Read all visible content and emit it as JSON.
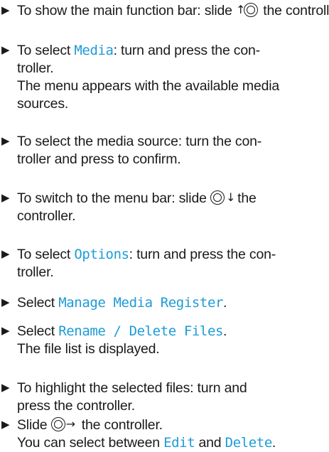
{
  "steps": [
    {
      "lines": [
        [
          {
            "t": "To show the main function bar: slide "
          },
          {
            "icon": "slide-up"
          },
          {
            "t": " the controller."
          }
        ]
      ]
    },
    {
      "lines": [
        [
          {
            "t": "To select "
          },
          {
            "ui": "Media"
          },
          {
            "t": ": turn and press the con-"
          }
        ],
        [
          {
            "t": "troller."
          }
        ],
        [
          {
            "t": "The menu appears with the available media"
          }
        ],
        [
          {
            "t": "sources."
          }
        ]
      ]
    },
    {
      "lines": [
        [
          {
            "t": "To select the media source: turn the con-"
          }
        ],
        [
          {
            "t": "troller and press to confirm."
          }
        ]
      ]
    },
    {
      "lines": [
        [
          {
            "t": "To switch to the menu bar: slide "
          },
          {
            "icon": "slide-down"
          },
          {
            "t": " the"
          }
        ],
        [
          {
            "t": "controller."
          }
        ]
      ]
    },
    {
      "lines": [
        [
          {
            "t": "To select "
          },
          {
            "ui": "Options"
          },
          {
            "t": ": turn and press the con-"
          }
        ],
        [
          {
            "t": "troller."
          }
        ]
      ]
    },
    {
      "lines": [
        [
          {
            "t": "Select "
          },
          {
            "ui": "Manage Media Register"
          },
          {
            "t": "."
          }
        ]
      ]
    },
    {
      "lines": [
        [
          {
            "t": "Select "
          },
          {
            "ui": "Rename / Delete Files"
          },
          {
            "t": "."
          }
        ],
        [
          {
            "t": "The file list is displayed."
          }
        ]
      ]
    },
    {
      "lines": [
        [
          {
            "t": "To highlight the selected files: turn and"
          }
        ],
        [
          {
            "t": "press the controller."
          }
        ]
      ]
    },
    {
      "lines": [
        [
          {
            "t": "Slide "
          },
          {
            "icon": "slide-right"
          },
          {
            "t": " the controller."
          }
        ],
        [
          {
            "t": "You can select between "
          },
          {
            "ui": "Edit"
          },
          {
            "t": " and "
          },
          {
            "ui": "Delete"
          },
          {
            "t": "."
          }
        ]
      ]
    }
  ],
  "bullet_glyph": "▶",
  "colors": {
    "text": "#1a1a1a",
    "ui_term": "#1d9bd7"
  },
  "icons": {
    "slide-up": "controller-slide-up-icon",
    "slide-down": "controller-slide-down-icon",
    "slide-right": "controller-slide-right-icon"
  }
}
